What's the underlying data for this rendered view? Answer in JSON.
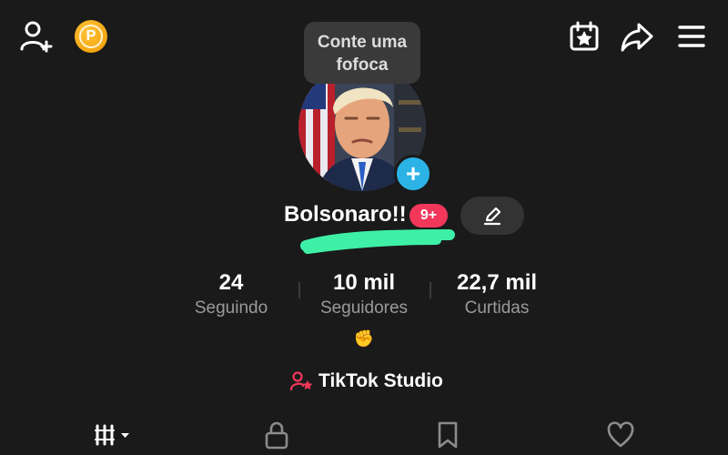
{
  "tooltip": {
    "line1": "Conte uma",
    "line2": "fofoca"
  },
  "profile": {
    "name": "Bolsonaro!!",
    "notifications": "9+",
    "bio_emoji": "✊"
  },
  "stats": [
    {
      "value": "24",
      "label": "Seguindo"
    },
    {
      "value": "10 mil",
      "label": "Seguidores"
    },
    {
      "value": "22,7 mil",
      "label": "Curtidas"
    }
  ],
  "studio": {
    "label": "TikTok Studio"
  },
  "coin": {
    "letter": "P"
  },
  "colors": {
    "background": "#1a1a1a",
    "accent_blue": "#2bb3e6",
    "badge_red": "#f2375b",
    "coin_orange": "#f5a30a",
    "scribble_green": "#3ef0a6",
    "studio_icon": "#f2375b"
  },
  "icons": {
    "top_left": [
      "add-user-icon",
      "coin-icon"
    ],
    "top_right": [
      "calendar-star-icon",
      "share-icon",
      "menu-icon"
    ],
    "bottom_tabs": [
      "videos-grid-icon",
      "lock-icon",
      "bookmark-icon",
      "heart-icon"
    ]
  }
}
